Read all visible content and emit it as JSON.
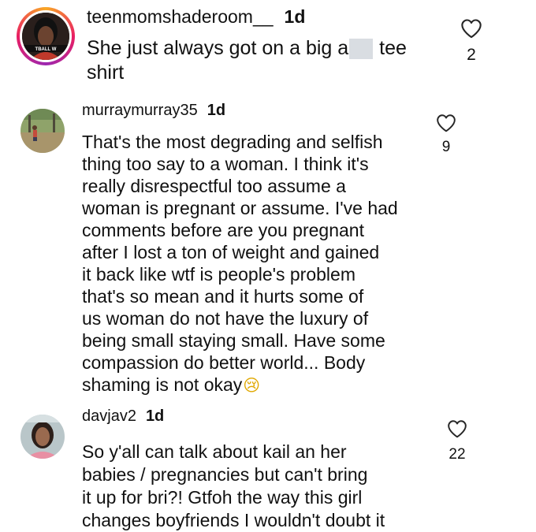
{
  "comments": [
    {
      "username": "teenmomshaderoom__",
      "age": "1d",
      "avatar_text": "TBALL W",
      "lines_before_redact": "She just always got on a big a",
      "lines_after_redact": "tee",
      "line2": "shirt",
      "likes": "2"
    },
    {
      "username": "murraymurray35",
      "age": "1d",
      "lines": [
        "That's the most degrading and selfish",
        "thing too say to a woman. I think it's",
        "really disrespectful too assume a",
        "woman is pregnant or assume. I've had",
        "comments before are you pregnant",
        "after I lost a ton of weight and gained",
        "it back like wtf is people's problem",
        "that's so mean and it hurts some of",
        "us woman do not have the luxury of",
        "being small staying small. Have some",
        "compassion do better world... Body",
        "shaming is not okay"
      ],
      "emoji": "😢",
      "likes": "9"
    },
    {
      "username": "davjav2",
      "age": "1d",
      "lines": [
        "So y'all can talk about kail an her",
        "babies / pregnancies but can't bring",
        "it up for bri?! Gtfoh the way this girl",
        "changes boyfriends I wouldn't doubt it"
      ],
      "likes": "22"
    }
  ],
  "colors": {
    "text": "#111111",
    "heart_outline": "#262626",
    "redaction": "#d9dde2"
  },
  "icons": {
    "like": "heart-outline-icon"
  }
}
